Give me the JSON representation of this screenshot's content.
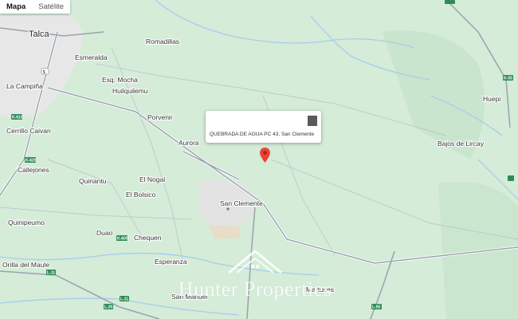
{
  "map_type": {
    "map_label": "Mapa",
    "satellite_label": "Satélite"
  },
  "places": {
    "talca": "Talca",
    "romadillas": "Romadillas",
    "esmeralda": "Esmeralda",
    "la_campina": "La Campiña",
    "esq_mocha": "Esq. Mocha",
    "huilquilemu": "Huilquilemu",
    "porvenir": "Porvenir",
    "cerrillo_caivan": "Cerrillo Caivan",
    "aurora": "Aurora",
    "callejones": "Callejones",
    "quinantu": "Quinantu",
    "el_nogal": "El Nogal",
    "el_bolsico": "El Bolsico",
    "san_clemente": "San Clemente",
    "quinipeumo": "Quinipeumo",
    "duao": "Duao",
    "chequen": "Chequen",
    "esperanza": "Esperanza",
    "orilla_del_maule": "Orilla del Maule",
    "san_manuel": "San Manuel",
    "la_tunes": "Ma tunes",
    "huepi": "Huepi",
    "bajos_de_lircay": "Bajos de Lircay"
  },
  "popup": {
    "address": "QUEBRADA DE AGUA PC 43, San Clemente"
  },
  "watermark": {
    "text": "Hunter Properties"
  },
  "colors": {
    "land": "#d4ecd8",
    "urban": "#e6e6e6",
    "road": "#9aa3ad",
    "river": "#a7cdee",
    "pin": "#ea4335",
    "shield": "#2e8b57"
  }
}
